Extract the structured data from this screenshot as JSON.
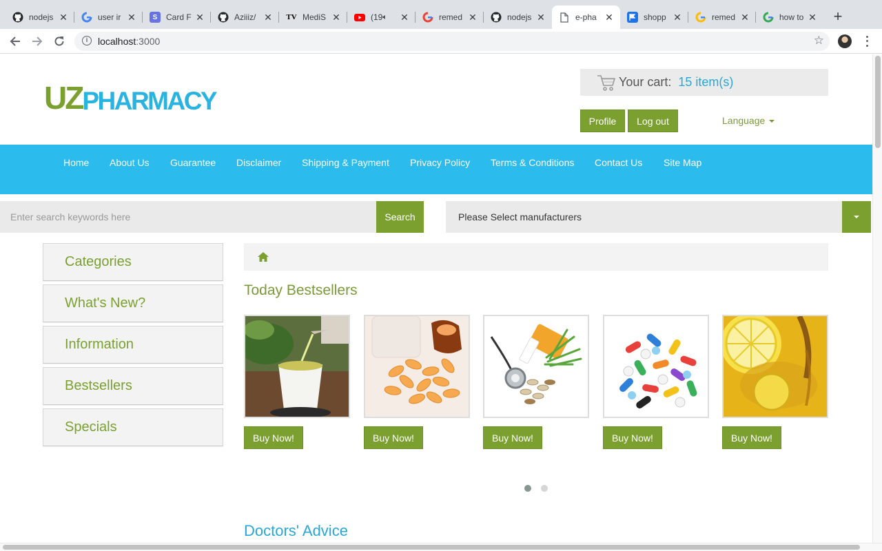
{
  "browser": {
    "tabs": [
      {
        "title": "nodejs",
        "icon": "github-icon",
        "active": false
      },
      {
        "title": "user ir",
        "icon": "google-icon",
        "active": false
      },
      {
        "title": "Card F",
        "icon": "stripe-icon",
        "active": false
      },
      {
        "title": "Aziiiz/",
        "icon": "github-icon",
        "active": false
      },
      {
        "title": "MediS",
        "icon": "tv-icon",
        "active": false
      },
      {
        "title": "(19",
        "icon": "youtube-icon",
        "active": false
      },
      {
        "title": "remed",
        "icon": "google-icon",
        "active": false
      },
      {
        "title": "nodejs",
        "icon": "github-icon",
        "active": false
      },
      {
        "title": "e-pha",
        "icon": "page-icon",
        "active": true
      },
      {
        "title": "shopp",
        "icon": "flag-icon",
        "active": false
      },
      {
        "title": "remed",
        "icon": "google-icon",
        "active": false
      },
      {
        "title": "how to",
        "icon": "google-icon",
        "active": false
      }
    ],
    "new_tab": "+",
    "url_host": "localhost",
    "url_port": ":3000"
  },
  "header": {
    "logo_uz": "UZ",
    "logo_pharmacy": "PHARMACY",
    "cart_label": "Your cart:",
    "cart_count": "15 item(s)",
    "profile_button": "Profile",
    "logout_button": "Log out",
    "language": "Language"
  },
  "nav": {
    "items": [
      "Home",
      "About Us",
      "Guarantee",
      "Disclaimer",
      "Shipping & Payment",
      "Privacy Policy",
      "Terms & Conditions",
      "Contact Us",
      "Site Map"
    ]
  },
  "search": {
    "placeholder": "Enter search keywords here",
    "button": "Search",
    "manufacturer_selected": "Please Select manufacturers"
  },
  "sidebar": {
    "items": [
      "Categories",
      "What's New?",
      "Information",
      "Bestsellers",
      "Specials"
    ]
  },
  "main": {
    "bestsellers_title": "Today Bestsellers",
    "products": [
      {
        "image": "green-tea-image",
        "button": "Buy Now!"
      },
      {
        "image": "orange-pills-image",
        "button": "Buy Now!"
      },
      {
        "image": "stethoscope-herbs-image",
        "button": "Buy Now!"
      },
      {
        "image": "colorful-pills-image",
        "button": "Buy Now!"
      },
      {
        "image": "lemon-tea-image",
        "button": "Buy Now!"
      }
    ],
    "carousel_pages": 2,
    "carousel_active": 1,
    "advice_title": "Doctors' Advice"
  },
  "colors": {
    "brand_green": "#7ba030",
    "brand_blue": "#2bbbec",
    "section_title_green": "#7a9a3a",
    "section_title_blue": "#29a7d6"
  }
}
